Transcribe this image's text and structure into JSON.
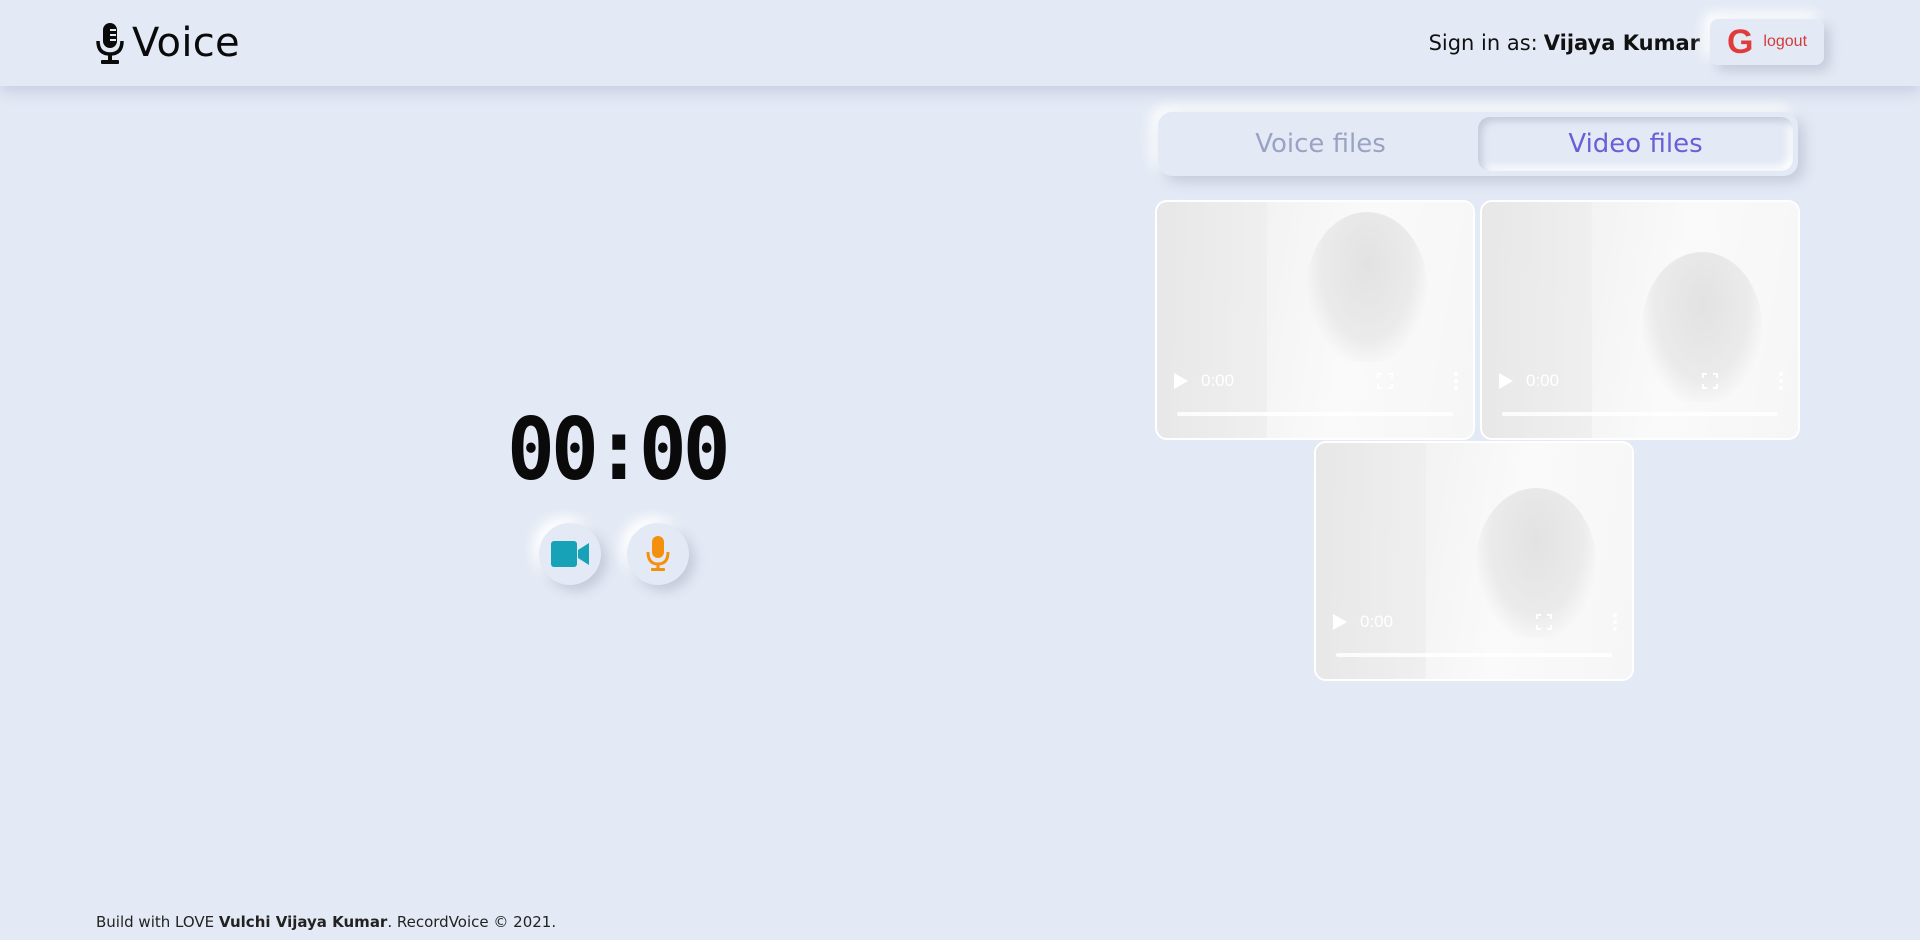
{
  "header": {
    "app_name": "Voice",
    "brand_icon": "microphone-icon",
    "signin_label": "Sign in as:",
    "user_name": "Vijaya Kumar",
    "logout": {
      "icon_text": "G",
      "label": "logout"
    }
  },
  "recorder": {
    "timer": "00:00",
    "video_button_icon": "video-camera-icon",
    "audio_button_icon": "microphone-icon",
    "colors": {
      "video": "#17a2b8",
      "audio": "#f5900e"
    }
  },
  "tabs": {
    "items": [
      {
        "label": "Voice files",
        "active": false
      },
      {
        "label": "Video files",
        "active": true
      }
    ],
    "active_color": "#6a5fd6",
    "inactive_color": "#9aa3c4"
  },
  "videos": [
    {
      "time": "0:00"
    },
    {
      "time": "0:00"
    },
    {
      "time": "0:00"
    }
  ],
  "footer": {
    "prefix": "Build with LOVE",
    "author": "Vulchi Vijaya Kumar",
    "suffix": ". RecordVoice © 2021."
  }
}
